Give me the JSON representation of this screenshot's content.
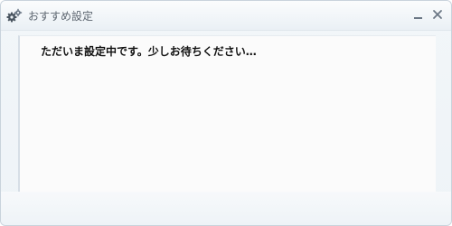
{
  "window": {
    "title": "おすすめ設定",
    "title_icon": "gears-icon",
    "minimize_icon": "minimize-icon",
    "close_icon": "close-icon"
  },
  "content": {
    "message": "ただいま設定中です。少しお待ちください…"
  },
  "colors": {
    "title_text": "#5d6670",
    "message_text": "#111111",
    "border": "#c9d3dc"
  }
}
